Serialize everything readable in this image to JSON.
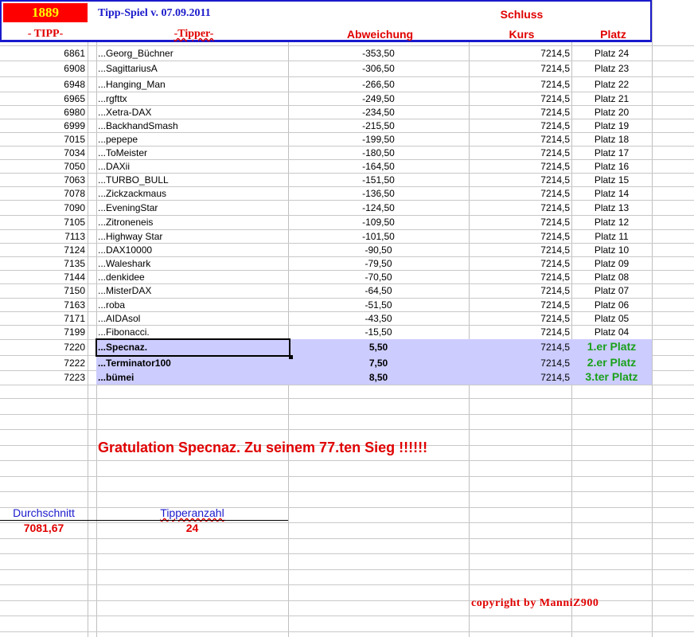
{
  "header": {
    "year": "1889",
    "title": "Tipp-Spiel v. 07.09.2011",
    "schluss": "Schluss",
    "col_tipp": "- TIPP-",
    "col_tipper": "-Tipper-",
    "col_abweichung": "Abweichung",
    "col_kurs": "Kurs",
    "col_platz": "Platz"
  },
  "rows": [
    {
      "tipp": "6861",
      "name": "...Georg_Büchner",
      "abw": "-353,50",
      "kurs": "7214,5",
      "platz": "Platz 24"
    },
    {
      "tipp": "6908",
      "name": "...SagittariusA",
      "abw": "-306,50",
      "kurs": "7214,5",
      "platz": "Platz 23"
    },
    {
      "tipp": "6948",
      "name": "...Hanging_Man",
      "abw": "-266,50",
      "kurs": "7214,5",
      "platz": "Platz 22"
    },
    {
      "tipp": "6965",
      "name": "...rgfttx",
      "abw": "-249,50",
      "kurs": "7214,5",
      "platz": "Platz 21"
    },
    {
      "tipp": "6980",
      "name": "...Xetra-DAX",
      "abw": "-234,50",
      "kurs": "7214,5",
      "platz": "Platz 20"
    },
    {
      "tipp": "6999",
      "name": "...BackhandSmash",
      "abw": "-215,50",
      "kurs": "7214,5",
      "platz": "Platz 19"
    },
    {
      "tipp": "7015",
      "name": "...pepepe",
      "abw": "-199,50",
      "kurs": "7214,5",
      "platz": "Platz 18"
    },
    {
      "tipp": "7034",
      "name": "...ToMeister",
      "abw": "-180,50",
      "kurs": "7214,5",
      "platz": "Platz 17"
    },
    {
      "tipp": "7050",
      "name": "...DAXii",
      "abw": "-164,50",
      "kurs": "7214,5",
      "platz": "Platz 16"
    },
    {
      "tipp": "7063",
      "name": "...TURBO_BULL",
      "abw": "-151,50",
      "kurs": "7214,5",
      "platz": "Platz 15"
    },
    {
      "tipp": "7078",
      "name": "...Zickzackmaus",
      "abw": "-136,50",
      "kurs": "7214,5",
      "platz": "Platz 14"
    },
    {
      "tipp": "7090",
      "name": "...EveningStar",
      "abw": "-124,50",
      "kurs": "7214,5",
      "platz": "Platz 13"
    },
    {
      "tipp": "7105",
      "name": "...Zitroneneis",
      "abw": "-109,50",
      "kurs": "7214,5",
      "platz": "Platz 12"
    },
    {
      "tipp": "7113",
      "name": "...Highway Star",
      "abw": "-101,50",
      "kurs": "7214,5",
      "platz": "Platz 11"
    },
    {
      "tipp": "7124",
      "name": "...DAX10000",
      "abw": "-90,50",
      "kurs": "7214,5",
      "platz": "Platz 10"
    },
    {
      "tipp": "7135",
      "name": "...Waleshark",
      "abw": "-79,50",
      "kurs": "7214,5",
      "platz": "Platz 09"
    },
    {
      "tipp": "7144",
      "name": "...denkidee",
      "abw": "-70,50",
      "kurs": "7214,5",
      "platz": "Platz 08"
    },
    {
      "tipp": "7150",
      "name": "...MisterDAX",
      "abw": "-64,50",
      "kurs": "7214,5",
      "platz": "Platz 07"
    },
    {
      "tipp": "7163",
      "name": "...roba",
      "abw": "-51,50",
      "kurs": "7214,5",
      "platz": "Platz 06"
    },
    {
      "tipp": "7171",
      "name": "...AIDAsol",
      "abw": "-43,50",
      "kurs": "7214,5",
      "platz": "Platz 05"
    },
    {
      "tipp": "7199",
      "name": "...Fibonacci.",
      "abw": "-15,50",
      "kurs": "7214,5",
      "platz": "Platz 04"
    },
    {
      "tipp": "7220",
      "name": "...Specnaz.",
      "abw": "5,50",
      "kurs": "7214,5",
      "platz": "1.er Platz",
      "winner": true
    },
    {
      "tipp": "7222",
      "name": "...Terminator100",
      "abw": "7,50",
      "kurs": "7214,5",
      "platz": "2.er Platz",
      "winner": true
    },
    {
      "tipp": "7223",
      "name": "...bümei",
      "abw": "8,50",
      "kurs": "7214,5",
      "platz": "3.ter Platz",
      "winner": true
    }
  ],
  "congrats": "Gratulation  Specnaz.  Zu seinem 77.ten Sieg !!!!!!",
  "stats": {
    "avg_label": "Durchschnitt",
    "avg_value": "7081,67",
    "count_label": "Tipperanzahl",
    "count_value": "24"
  },
  "copyright": "copyright by ManniZ900",
  "colors": {
    "highlight": "#ccccff",
    "red": "#e00000",
    "green": "#1aa01a",
    "blue": "#1a1acc"
  }
}
